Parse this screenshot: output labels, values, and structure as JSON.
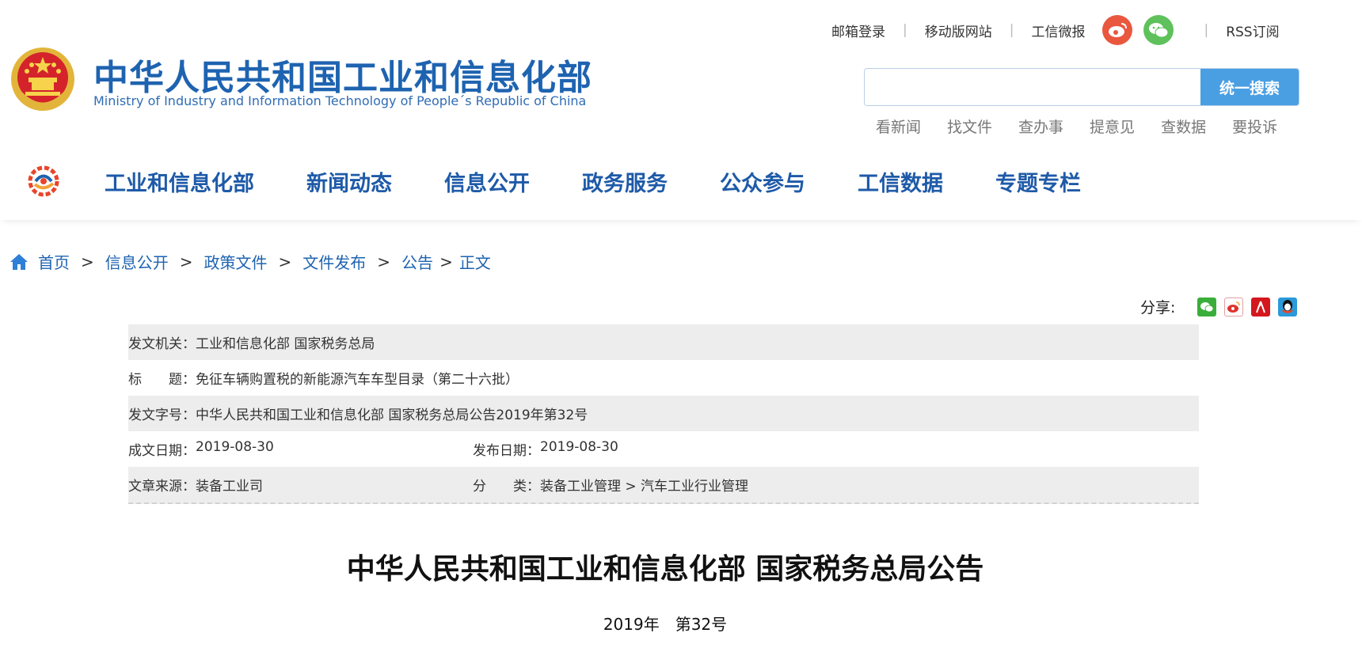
{
  "header": {
    "title": "中华人民共和国工业和信息化部",
    "subtitle": "Ministry of Industry and Information Technology of People´s Republic of China",
    "top_links": {
      "mail_login": "邮箱登录",
      "mobile_site": "移动版网站",
      "weibao": "工信微报",
      "rss": "RSS订阅",
      "separator": "|"
    },
    "search": {
      "placeholder": "",
      "button_label": "统一搜索"
    },
    "quick_links": [
      "看新闻",
      "找文件",
      "查办事",
      "提意见",
      "查数据",
      "要投诉"
    ]
  },
  "nav": {
    "items": [
      "工业和信息化部",
      "新闻动态",
      "信息公开",
      "政务服务",
      "公众参与",
      "工信数据",
      "专题专栏"
    ]
  },
  "breadcrumb": {
    "items": [
      "首页",
      "信息公开",
      "政策文件",
      "文件发布",
      "公告"
    ],
    "current": "正文",
    "separator": ">"
  },
  "share": {
    "label": "分享:",
    "icons": [
      "wechat-icon",
      "weibo-icon",
      "renren-icon",
      "qq-icon"
    ]
  },
  "meta": {
    "issuer_label": "发文机关：",
    "issuer": "工业和信息化部 国家税务总局",
    "title_label": "标　　题：",
    "title": "免征车辆购置税的新能源汽车车型目录（第二十六批）",
    "doc_no_label": "发文字号：",
    "doc_no": "中华人民共和国工业和信息化部 国家税务总局公告2019年第32号",
    "created_label": "成文日期：",
    "created": "2019-08-30",
    "published_label": "发布日期：",
    "published": "2019-08-30",
    "source_label": "文章来源：",
    "source": "装备工业司",
    "category_label": "分　　类：",
    "category": "装备工业管理 > 汽车工业行业管理"
  },
  "article": {
    "title": "中华人民共和国工业和信息化部 国家税务总局公告",
    "number": "2019年　第32号"
  },
  "colors": {
    "brand_blue": "#1e63b0",
    "search_button": "#4a9fe3",
    "weibo_red": "#e9573f",
    "wechat_green": "#5fc15b",
    "row_shade": "#ededed"
  }
}
